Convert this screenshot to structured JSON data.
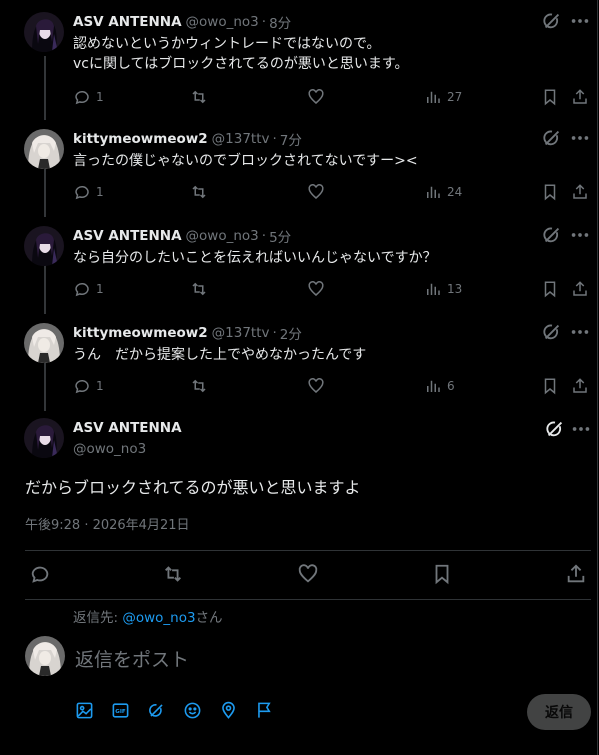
{
  "replies": [
    {
      "name": "ASV ANTENNA",
      "handle": "@owo_no3",
      "time": "8分",
      "line1": "認めないというかウィントレードではないので。",
      "line2": "vcに関してはブロックされてるのが悪いと思います。",
      "reply_count": "1",
      "views": "27"
    },
    {
      "name": "kittymeowmeow2",
      "handle": "@137ttv",
      "time": "7分",
      "line1": "言ったの僕じゃないのでブロックされてないですー><",
      "reply_count": "1",
      "views": "24"
    },
    {
      "name": "ASV ANTENNA",
      "handle": "@owo_no3",
      "time": "5分",
      "line1": "なら自分のしたいことを伝えればいいんじゃないですか？",
      "reply_count": "1",
      "views": "13"
    },
    {
      "name": "kittymeowmeow2",
      "handle": "@137ttv",
      "time": "2分",
      "line1": "うん　だから提案した上でやめなかったんです",
      "reply_count": "1",
      "views": "6"
    }
  ],
  "main": {
    "name": "ASV ANTENNA",
    "handle": "@owo_no3",
    "text": "だからブロックされてるのが悪いと思いますよ",
    "datetime": "午後9:28 · 2026年4月21日"
  },
  "composer": {
    "reply_to_label": "返信先: ",
    "reply_to_handle": "@owo_no3",
    "reply_to_suffix": "さん",
    "placeholder": "返信をポスト",
    "submit_label": "返信",
    "gif_label": "GIF"
  },
  "separator": "·",
  "colors": {
    "accent": "#1d9bf0",
    "muted": "#71767b",
    "text": "#e7e9ea",
    "background": "#000000"
  }
}
